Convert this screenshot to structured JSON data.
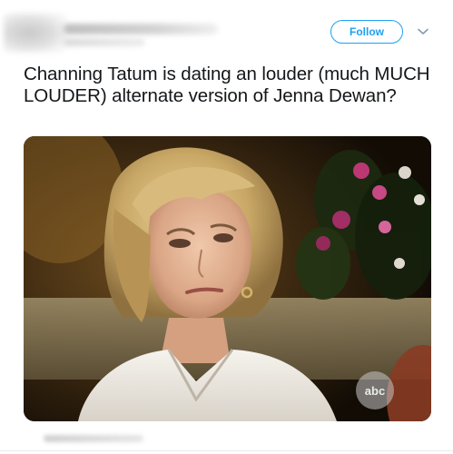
{
  "header": {
    "follow_label": "Follow",
    "menu_icon": "chevron-down-icon"
  },
  "tweet": {
    "text": "Channing Tatum is dating an louder (much MUCH LOUDER) alternate version of Jenna Dewan?"
  },
  "media": {
    "watermark": "abc"
  },
  "colors": {
    "accent": "#1da1f2",
    "text": "#14171a"
  }
}
